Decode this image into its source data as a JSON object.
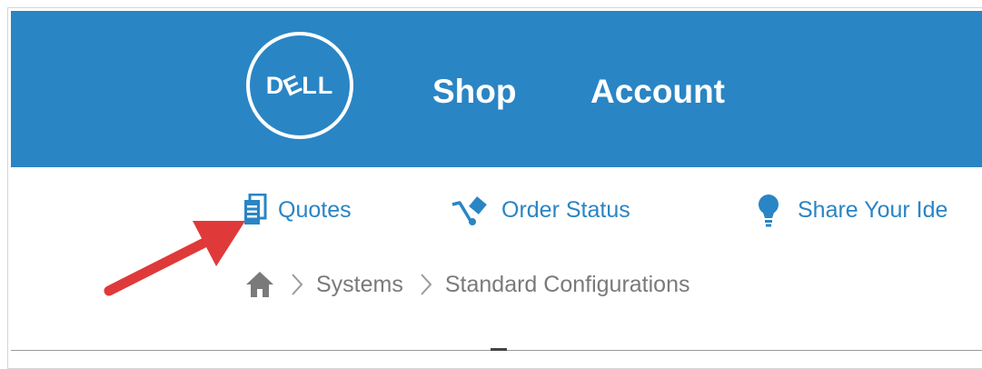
{
  "header": {
    "logo_text": "DELL",
    "nav": [
      {
        "label": "Shop"
      },
      {
        "label": "Account"
      }
    ]
  },
  "subnav": {
    "items": [
      {
        "label": "Quotes",
        "icon": "document-list-icon"
      },
      {
        "label": "Order Status",
        "icon": "hand-truck-icon"
      },
      {
        "label": "Share Your Ide",
        "icon": "lightbulb-icon"
      }
    ]
  },
  "breadcrumb": {
    "home_icon": "home-icon",
    "items": [
      {
        "label": "Systems"
      },
      {
        "label": "Standard Configurations"
      }
    ]
  },
  "colors": {
    "brand_blue": "#2a85c4",
    "breadcrumb_gray": "#7a7a7a",
    "annotation_red": "#e0393a"
  }
}
